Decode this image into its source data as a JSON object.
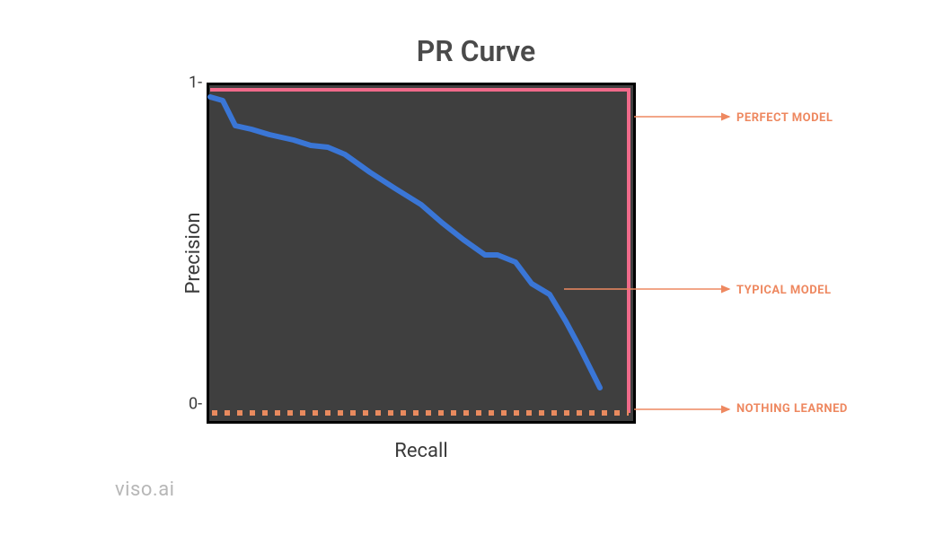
{
  "title": "PR Curve",
  "ylabel": "Precision",
  "xlabel": "Recall",
  "brand": "viso.ai",
  "ticks": {
    "y_top": "1",
    "y_bottom": "0"
  },
  "annotations": {
    "perfect": "PERFECT MODEL",
    "typical": "TYPICAL MODEL",
    "nothing": "NOTHING LEARNED"
  },
  "colors": {
    "plot_bg": "#3f3f3f",
    "perfect_line": "#f06a8a",
    "typical_line": "#3a76d6",
    "nothing_line": "#e98a5e",
    "annotation_text": "#ee8860",
    "arrow": "#ee8860"
  },
  "chart_data": {
    "type": "line",
    "title": "PR Curve",
    "xlabel": "Recall",
    "ylabel": "Precision",
    "xlim": [
      0,
      1
    ],
    "ylim": [
      0,
      1
    ],
    "legend_position": "right-external",
    "grid": false,
    "series": [
      {
        "name": "PERFECT MODEL",
        "style": "solid",
        "color": "#f06a8a",
        "x": [
          0,
          1,
          1
        ],
        "y": [
          1,
          1,
          0
        ]
      },
      {
        "name": "TYPICAL MODEL",
        "style": "solid",
        "color": "#3a76d6",
        "x": [
          0.0,
          0.03,
          0.06,
          0.1,
          0.14,
          0.2,
          0.24,
          0.28,
          0.32,
          0.38,
          0.44,
          0.5,
          0.55,
          0.6,
          0.65,
          0.68,
          0.72,
          0.76,
          0.8,
          0.84,
          0.87,
          0.9,
          0.92
        ],
        "y": [
          0.98,
          0.97,
          0.9,
          0.89,
          0.87,
          0.85,
          0.83,
          0.83,
          0.8,
          0.75,
          0.7,
          0.65,
          0.6,
          0.55,
          0.5,
          0.5,
          0.48,
          0.42,
          0.38,
          0.3,
          0.22,
          0.15,
          0.1
        ]
      },
      {
        "name": "NOTHING LEARNED",
        "style": "dotted",
        "color": "#e98a5e",
        "x": [
          0,
          1
        ],
        "y": [
          0,
          0
        ]
      }
    ]
  }
}
